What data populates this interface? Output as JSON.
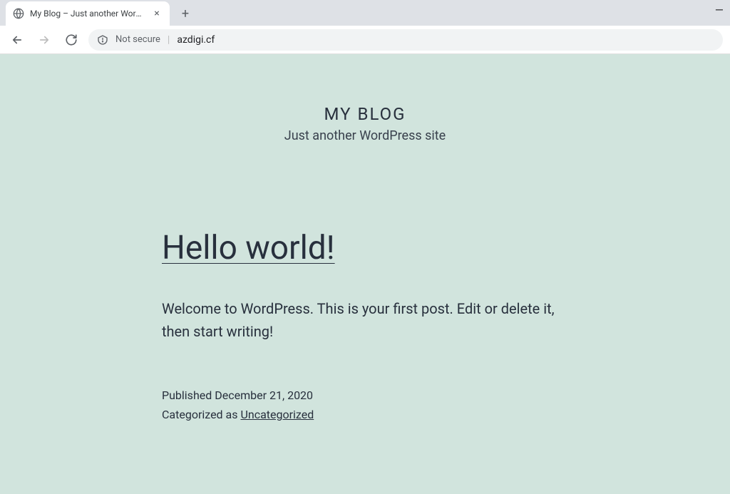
{
  "browser": {
    "tab_title": "My Blog – Just another WordPres",
    "security_label": "Not secure",
    "url": "azdigi.cf"
  },
  "site": {
    "title": "MY BLOG",
    "tagline": "Just another WordPress site"
  },
  "post": {
    "title": "Hello world!",
    "excerpt": "Welcome to WordPress. This is your first post. Edit or delete it, then start writing!",
    "published_prefix": "Published ",
    "published_date": "December 21, 2020",
    "categorized_prefix": "Categorized as ",
    "category": "Uncategorized"
  },
  "colors": {
    "page_bg": "#d1e4dd",
    "text": "#28303d"
  }
}
